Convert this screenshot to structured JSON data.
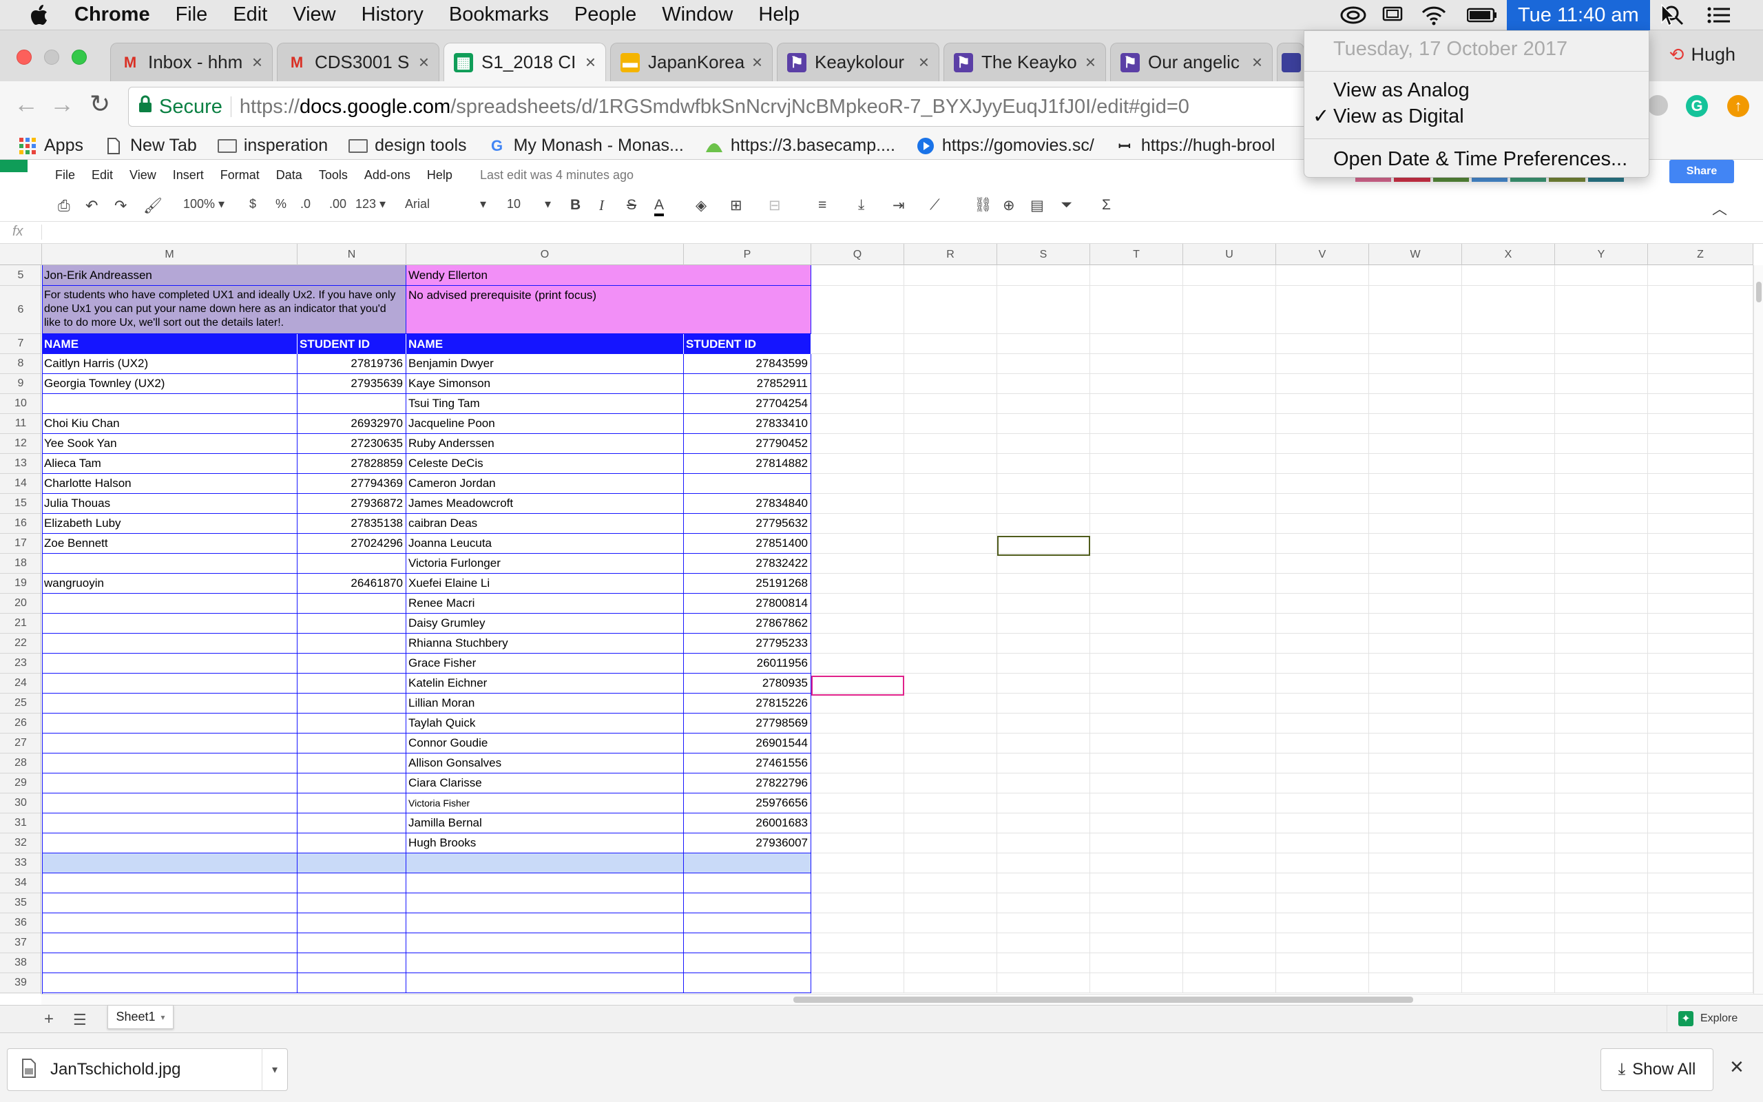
{
  "menubar": {
    "app": "Chrome",
    "items": [
      "File",
      "Edit",
      "View",
      "History",
      "Bookmarks",
      "People",
      "Window",
      "Help"
    ],
    "clock": "Tue 11:40 am"
  },
  "clock_menu": {
    "date": "Tuesday, 17 October 2017",
    "analog": "View as Analog",
    "digital": "View as Digital",
    "check": "✓",
    "prefs": "Open Date & Time Preferences..."
  },
  "tabs": [
    {
      "title": "Inbox - hhm",
      "icon": "gmail-icon",
      "glyph": "M",
      "color": "#d93025"
    },
    {
      "title": "CDS3001 S",
      "icon": "gmail-icon",
      "glyph": "M",
      "color": "#d93025"
    },
    {
      "title": "S1_2018 CI",
      "icon": "sheets-icon",
      "glyph": "▦",
      "color": "#0f9d58"
    },
    {
      "title": "JapanKorea",
      "icon": "slides-icon",
      "glyph": "▬",
      "color": "#f4b400"
    },
    {
      "title": "Keaykolour",
      "icon": "site-icon",
      "glyph": "⚑",
      "color": "#5b3fa6"
    },
    {
      "title": "The Keayko",
      "icon": "site-icon",
      "glyph": "⚑",
      "color": "#5b3fa6"
    },
    {
      "title": "Our angelic",
      "icon": "site-icon",
      "glyph": "⚑",
      "color": "#5b3fa6"
    }
  ],
  "tab_close": "×",
  "profile": "Hugh",
  "omnibox": {
    "secure": "Secure",
    "scheme": "https://",
    "host": "docs.google.com",
    "path": "/spreadsheets/d/1RGSmdwfbkSnNcrvjNcBMpkeoR-7_BYXJyyEuqJ1fJ0I/edit#gid=0"
  },
  "bookmarks": [
    {
      "label": "Apps",
      "icon": "apps-icon"
    },
    {
      "label": "New Tab",
      "icon": "page-icon"
    },
    {
      "label": "insperation",
      "icon": "folder-icon"
    },
    {
      "label": "design tools",
      "icon": "folder-icon"
    },
    {
      "label": "My Monash - Monas...",
      "icon": "google-icon"
    },
    {
      "label": "https://3.basecamp....",
      "icon": "basecamp-icon"
    },
    {
      "label": "https://gomovies.sc/",
      "icon": "play-icon"
    },
    {
      "label": "https://hugh-brool",
      "icon": "site-icon"
    }
  ],
  "sheets_menu": {
    "items": [
      "File",
      "Edit",
      "View",
      "Insert",
      "Format",
      "Data",
      "Tools",
      "Add-ons",
      "Help"
    ],
    "last_edit": "Last edit was 4 minutes ago",
    "share": "Share"
  },
  "toolbar": {
    "zoom": "100%",
    "currency": "$",
    "percent": "%",
    "dec_less": ".0",
    "dec_more": ".00",
    "format_more": "123",
    "font": "Arial",
    "size": "10",
    "bold": "B",
    "italic": "I",
    "strike": "S",
    "textcolor": "A",
    "sum": "Σ"
  },
  "fx": "fx",
  "columns": [
    "M",
    "N",
    "O",
    "P",
    "Q",
    "R",
    "S",
    "T",
    "U",
    "V",
    "W",
    "X",
    "Y",
    "Z"
  ],
  "rows": [
    "5",
    "6",
    "7",
    "8",
    "9",
    "10",
    "11",
    "12",
    "13",
    "14",
    "15",
    "16",
    "17",
    "18",
    "19",
    "20",
    "21",
    "22",
    "23",
    "24",
    "25",
    "26",
    "27",
    "28",
    "29",
    "30",
    "31",
    "32",
    "33",
    "34",
    "35",
    "36",
    "37",
    "38",
    "39"
  ],
  "sheet": {
    "row5": {
      "m": "Jon-Erik Andreassen",
      "o": "Wendy Ellerton"
    },
    "row6": {
      "m": "For students who have completed UX1 and ideally Ux2. If you have only done Ux1 you can put your name down here as an indicator that you'd like to do more Ux, we'll sort out the details later!.",
      "o": "No advised prerequisite (print focus)"
    },
    "headers": {
      "m": "NAME",
      "n": "STUDENT ID",
      "o": "NAME",
      "p": "STUDENT ID"
    },
    "data": [
      [
        "Caitlyn Harris (UX2)",
        "27819736",
        "Benjamin Dwyer",
        "27843599"
      ],
      [
        "Georgia Townley (UX2)",
        "27935639",
        "Kaye Simonson",
        "27852911"
      ],
      [
        "",
        "",
        "Tsui Ting Tam",
        "27704254"
      ],
      [
        "Choi Kiu Chan",
        "26932970",
        "Jacqueline Poon",
        "27833410"
      ],
      [
        "Yee Sook Yan",
        "27230635",
        "Ruby Anderssen",
        "27790452"
      ],
      [
        "Alieca Tam",
        "27828859",
        "Celeste DeCis",
        "27814882"
      ],
      [
        "Charlotte Halson",
        "27794369",
        "Cameron Jordan",
        ""
      ],
      [
        "Julia Thouas",
        "27936872",
        "James Meadowcroft",
        "27834840"
      ],
      [
        "Elizabeth Luby",
        "27835138",
        "caibran Deas",
        "27795632"
      ],
      [
        "Zoe Bennett",
        "27024296",
        "Joanna Leucuta",
        "27851400"
      ],
      [
        "",
        "",
        "Victoria Furlonger",
        "27832422"
      ],
      [
        "wangruoyin",
        "26461870",
        "Xuefei Elaine Li",
        "25191268"
      ],
      [
        "",
        "",
        "Renee Macri",
        "27800814"
      ],
      [
        "",
        "",
        "Daisy Grumley",
        "27867862"
      ],
      [
        "",
        "",
        "Rhianna Stuchbery",
        "27795233"
      ],
      [
        "",
        "",
        " Grace Fisher",
        "26011956"
      ],
      [
        "",
        "",
        " Katelin Eichner",
        "2780935"
      ],
      [
        "",
        "",
        "Lillian Moran",
        "27815226"
      ],
      [
        "",
        "",
        "Taylah Quick",
        "27798569"
      ],
      [
        "",
        "",
        "Connor Goudie",
        "26901544"
      ],
      [
        "",
        "",
        "Allison Gonsalves",
        "27461556"
      ],
      [
        "",
        "",
        "Ciara Clarisse",
        "27822796"
      ],
      [
        "",
        "",
        "Victoria Fisher",
        "25976656"
      ],
      [
        "",
        "",
        "Jamilla Bernal",
        "26001683"
      ],
      [
        "",
        "",
        "Hugh Brooks",
        "27936007"
      ]
    ]
  },
  "sheet_tab": "Sheet1",
  "add_sheet": "+",
  "explore": "Explore",
  "download": {
    "file": "JanTschichold.jpg",
    "show_all": "Show All",
    "close": "×"
  }
}
